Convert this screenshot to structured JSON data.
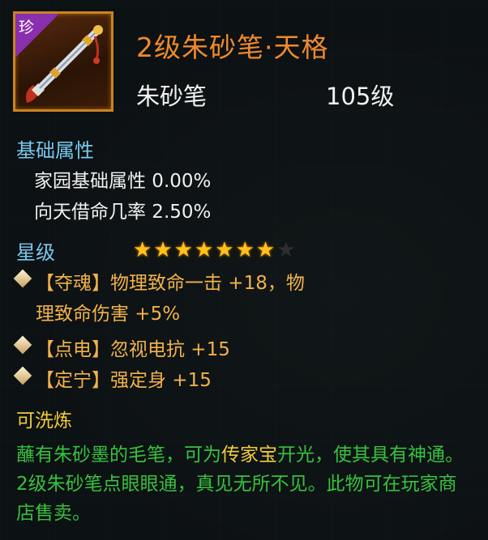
{
  "item": {
    "rarity_tag": "珍",
    "title": "2级朱砂笔·天格",
    "type": "朱砂笔",
    "level": "105级"
  },
  "base_attrs": {
    "heading": "基础属性",
    "lines": [
      "家园基础属性 0.00%",
      "向天借命几率 2.50%"
    ]
  },
  "star_rating": {
    "heading": "星级",
    "filled": 7,
    "total": 8
  },
  "effects": [
    {
      "line1": "【夺魂】物理致命一击 +18，物",
      "line2": "理致命伤害 +5%"
    },
    {
      "line1": "【点电】忽视电抗 +15"
    },
    {
      "line1": "【定宁】强定身 +15"
    }
  ],
  "refine_note": "可洗炼",
  "description": {
    "part1": "蘸有朱砂墨的毛笔，可为",
    "highlight": "传家宝",
    "part2": "开光，使其具有神通。2级朱砂笔点眼眼通，真见无所不见。此物可在玩家商店售卖。"
  },
  "colors": {
    "title": "#ef8a2c",
    "section": "#78c8ee",
    "effect": "#f2b24a",
    "description": "#38c13e",
    "highlight": "#f2cc3a",
    "rarity": "#8a2fb0"
  },
  "icons": [
    "brush-item-icon",
    "star-icon",
    "diamond-bullet-icon"
  ]
}
